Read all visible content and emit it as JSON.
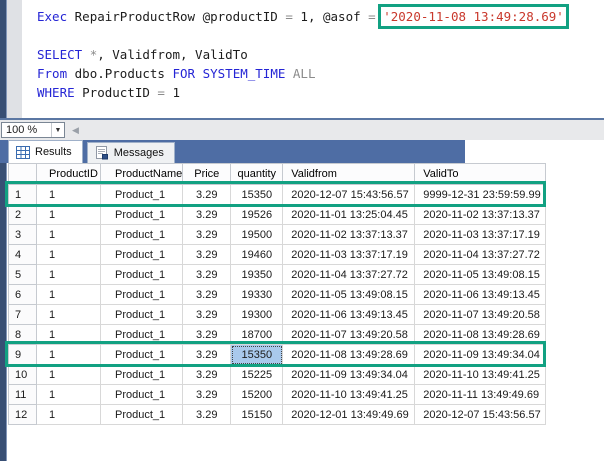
{
  "editor": {
    "code_lines": [
      {
        "tokens": [
          {
            "text": "Exec ",
            "type": "kw"
          },
          {
            "text": "RepairProductRow @productID ",
            "type": "pl"
          },
          {
            "text": "= ",
            "type": "op"
          },
          {
            "text": "1, @asof ",
            "type": "pl"
          },
          {
            "text": "= ",
            "type": "op"
          },
          {
            "text": "'2020-11-08 13:49:28.69'",
            "type": "str",
            "boxed": true
          }
        ]
      },
      {
        "tokens": []
      },
      {
        "tokens": [
          {
            "text": "SELECT ",
            "type": "kw"
          },
          {
            "text": "*",
            "type": "op"
          },
          {
            "text": ", Validfrom, ValidTo",
            "type": "pl"
          }
        ]
      },
      {
        "tokens": [
          {
            "text": "From ",
            "type": "kw"
          },
          {
            "text": "dbo.Products ",
            "type": "pl"
          },
          {
            "text": "FOR SYSTEM_TIME ",
            "type": "kw"
          },
          {
            "text": "ALL",
            "type": "op"
          }
        ]
      },
      {
        "tokens": [
          {
            "text": "WHERE ",
            "type": "kw"
          },
          {
            "text": "ProductID ",
            "type": "pl"
          },
          {
            "text": "= ",
            "type": "op"
          },
          {
            "text": "1",
            "type": "pl"
          }
        ]
      }
    ]
  },
  "toolbar": {
    "zoom_value": "100 %"
  },
  "tabs": [
    {
      "label": "Results",
      "icon": "results-grid-icon",
      "active": true
    },
    {
      "label": "Messages",
      "icon": "messages-icon",
      "active": false
    }
  ],
  "grid": {
    "columns": [
      "ProductID",
      "ProductName",
      "Price",
      "quantity",
      "Validfrom",
      "ValidTo"
    ],
    "rows": [
      {
        "num": "1",
        "cells": [
          "1",
          "Product_1",
          "3.29",
          "15350",
          "2020-12-07 15:43:56.57",
          "9999-12-31 23:59:59.99"
        ]
      },
      {
        "num": "2",
        "cells": [
          "1",
          "Product_1",
          "3.29",
          "19526",
          "2020-11-01 13:25:04.45",
          "2020-11-02 13:37:13.37"
        ]
      },
      {
        "num": "3",
        "cells": [
          "1",
          "Product_1",
          "3.29",
          "19500",
          "2020-11-02 13:37:13.37",
          "2020-11-03 13:37:17.19"
        ]
      },
      {
        "num": "4",
        "cells": [
          "1",
          "Product_1",
          "3.29",
          "19460",
          "2020-11-03 13:37:17.19",
          "2020-11-04 13:37:27.72"
        ]
      },
      {
        "num": "5",
        "cells": [
          "1",
          "Product_1",
          "3.29",
          "19350",
          "2020-11-04 13:37:27.72",
          "2020-11-05 13:49:08.15"
        ]
      },
      {
        "num": "6",
        "cells": [
          "1",
          "Product_1",
          "3.29",
          "19330",
          "2020-11-05 13:49:08.15",
          "2020-11-06 13:49:13.45"
        ]
      },
      {
        "num": "7",
        "cells": [
          "1",
          "Product_1",
          "3.29",
          "19300",
          "2020-11-06 13:49:13.45",
          "2020-11-07 13:49:20.58"
        ]
      },
      {
        "num": "8",
        "cells": [
          "1",
          "Product_1",
          "3.29",
          "18700",
          "2020-11-07 13:49:20.58",
          "2020-11-08 13:49:28.69"
        ]
      },
      {
        "num": "9",
        "cells": [
          "1",
          "Product_1",
          "3.29",
          "15350",
          "2020-11-08 13:49:28.69",
          "2020-11-09 13:49:34.04"
        ]
      },
      {
        "num": "10",
        "cells": [
          "1",
          "Product_1",
          "3.29",
          "15225",
          "2020-11-09 13:49:34.04",
          "2020-11-10 13:49:41.25"
        ]
      },
      {
        "num": "11",
        "cells": [
          "1",
          "Product_1",
          "3.29",
          "15200",
          "2020-11-10 13:49:41.25",
          "2020-11-11 13:49:49.69"
        ]
      },
      {
        "num": "12",
        "cells": [
          "1",
          "Product_1",
          "3.29",
          "15150",
          "2020-12-01 13:49:49.69",
          "2020-12-07 15:43:56.57"
        ]
      }
    ],
    "selected_cell": {
      "row_num": "9",
      "col_index": 3
    }
  },
  "annotations": {
    "boxed_rows": [
      "1",
      "9"
    ],
    "boxed_code_string": "'2020-11-08 13:49:28.69'"
  },
  "colors": {
    "highlight_green": "#12a182",
    "selected_cell_blue": "#a9c9ec",
    "keyword_blue": "#2525d5",
    "string_red": "#c9382c",
    "window_navy": "#384f74",
    "tab_well_blue": "#4e6da4"
  }
}
